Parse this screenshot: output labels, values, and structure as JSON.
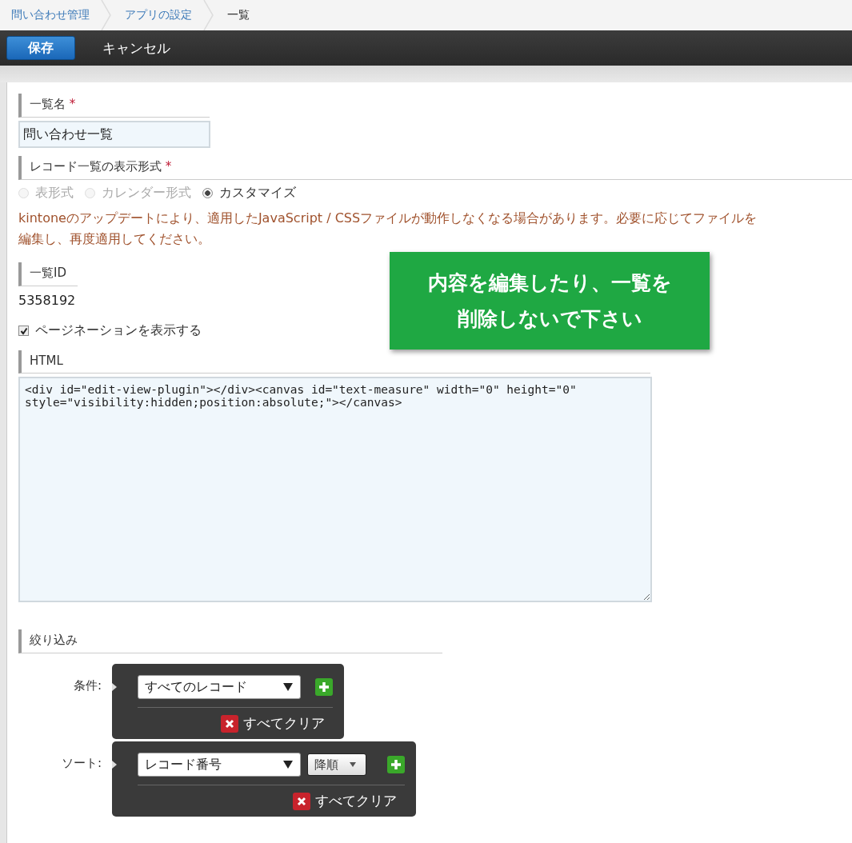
{
  "breadcrumbs": [
    {
      "label": "問い合わせ管理",
      "link": true
    },
    {
      "label": "アプリの設定",
      "link": true
    },
    {
      "label": "一覧",
      "link": false
    }
  ],
  "toolbar": {
    "save": "保存",
    "cancel": "キャンセル"
  },
  "view_name": {
    "label": "一覧名",
    "required_mark": "*",
    "value": "問い合わせ一覧"
  },
  "display_format": {
    "label": "レコード一覧の表示形式",
    "required_mark": "*",
    "options": [
      {
        "label": "表形式",
        "selected": false,
        "disabled": true
      },
      {
        "label": "カレンダー形式",
        "selected": false,
        "disabled": true
      },
      {
        "label": "カスタマイズ",
        "selected": true,
        "disabled": false
      }
    ],
    "warning": "kintoneのアップデートにより、適用したJavaScript / CSSファイルが動作しなくなる場合があります。必要に応じてファイルを編集し、再度適用してください。"
  },
  "view_id": {
    "label": "一覧ID",
    "value": "5358192"
  },
  "pagination": {
    "label": "ページネーションを表示する",
    "checked": true
  },
  "html": {
    "label": "HTML",
    "value": "<div id=\"edit-view-plugin\"></div><canvas id=\"text-measure\" width=\"0\" height=\"0\" style=\"visibility:hidden;position:absolute;\"></canvas>"
  },
  "filter": {
    "label": "絞り込み",
    "rows": [
      {
        "label": "条件:",
        "select": "すべてのレコード",
        "clear": "すべてクリア"
      },
      {
        "label": "ソート:",
        "select": "レコード番号",
        "order": "降順",
        "clear": "すべてクリア"
      }
    ]
  },
  "callout": {
    "lines": [
      "内容を編集したり、一覧を",
      "削除しないで下さい"
    ]
  }
}
